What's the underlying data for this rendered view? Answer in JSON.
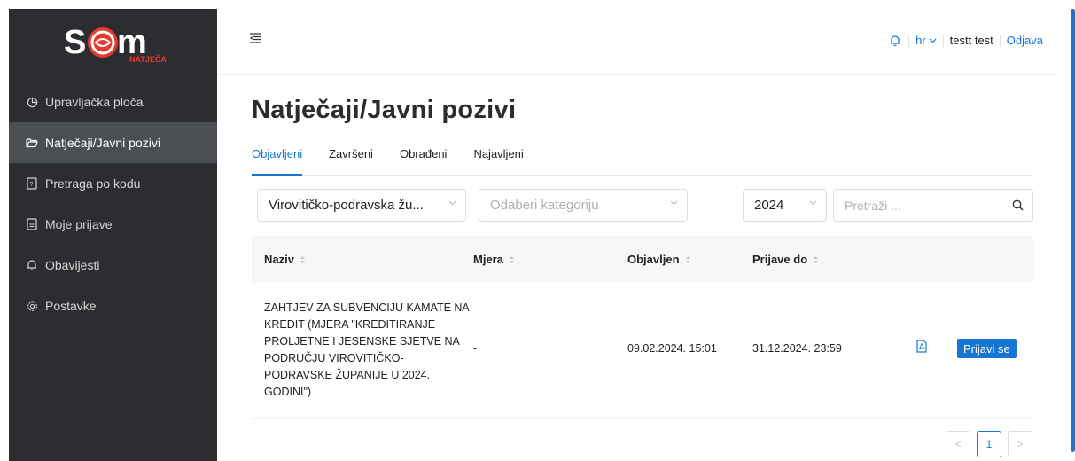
{
  "brand": {
    "logo_text": "NATJEČAJI",
    "logo_mark": "SOM"
  },
  "sidebar": {
    "items": [
      {
        "label": "Upravljačka ploča",
        "icon": "dashboard-icon"
      },
      {
        "label": "Natječaji/Javni pozivi",
        "icon": "folder-open-icon",
        "active": true
      },
      {
        "label": "Pretraga po kodu",
        "icon": "document-search-icon"
      },
      {
        "label": "Moje prijave",
        "icon": "document-icon"
      },
      {
        "label": "Obavijesti",
        "icon": "bell-icon"
      },
      {
        "label": "Postavke",
        "icon": "gear-icon"
      }
    ]
  },
  "header": {
    "language": "hr",
    "user": "testt test",
    "logout": "Odjava"
  },
  "page": {
    "title": "Natječaji/Javni pozivi",
    "tabs": [
      "Objavljeni",
      "Završeni",
      "Obrađeni",
      "Najavljeni"
    ],
    "active_tab": "Objavljeni"
  },
  "filters": {
    "region": "Virovitičko-podravska žu...",
    "category_placeholder": "Odaberi kategoriju",
    "year": "2024",
    "search_placeholder": "Pretraži ..."
  },
  "table": {
    "columns": [
      "Naziv",
      "Mjera",
      "Objavljen",
      "Prijave do"
    ],
    "rows": [
      {
        "naziv": "ZAHTJEV ZA SUBVENCIJU KAMATE NA KREDIT (MJERA \"KREDITIRANJE PROLJETNE I JESENSKE SJETVE NA PODRUČJU VIROVITIČKO-PODRAVSKE ŽUPANIJE U 2024. GODINI\")",
        "mjera": "-",
        "objavljen": "09.02.2024. 15:01",
        "prijave_do": "31.12.2024. 23:59",
        "action": "Prijavi se"
      }
    ]
  },
  "pagination": {
    "prev": "<",
    "current": "1",
    "next": ">"
  },
  "colors": {
    "accent": "#1677d2",
    "sidebar_bg": "#2b2d30",
    "sidebar_active": "#4b4f54",
    "logo_red": "#e53a2f"
  }
}
